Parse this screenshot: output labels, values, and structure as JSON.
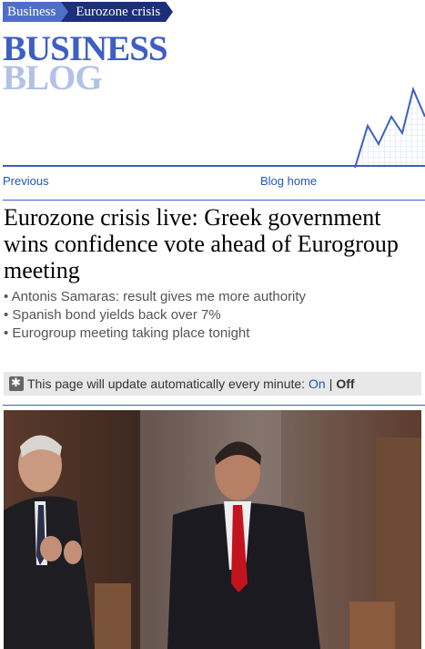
{
  "breadcrumb": {
    "section": "Business",
    "topic": "Eurozone crisis"
  },
  "logo": {
    "line1": "BUSINESS",
    "line2": "BLOG"
  },
  "nav": {
    "previous": "Previous",
    "blog_home": "Blog home"
  },
  "article": {
    "headline": "Eurozone crisis live: Greek government wins confidence vote ahead of Eurogroup meeting",
    "bullets": [
      "Antonis Samaras: result gives me more authority",
      "Spanish bond yields back over 7%",
      "Eurogroup meeting taking place tonight"
    ]
  },
  "auto_update": {
    "text": "This page will update automatically every minute:",
    "on_label": "On",
    "separator": "|",
    "off_label": "Off",
    "current": "Off"
  },
  "colors": {
    "brand_blue": "#3d5fc2",
    "dark_blue": "#1b2f7a",
    "link": "#2457b5"
  },
  "icons": {
    "update": "refresh-icon",
    "graph": "rising-graph-icon"
  }
}
